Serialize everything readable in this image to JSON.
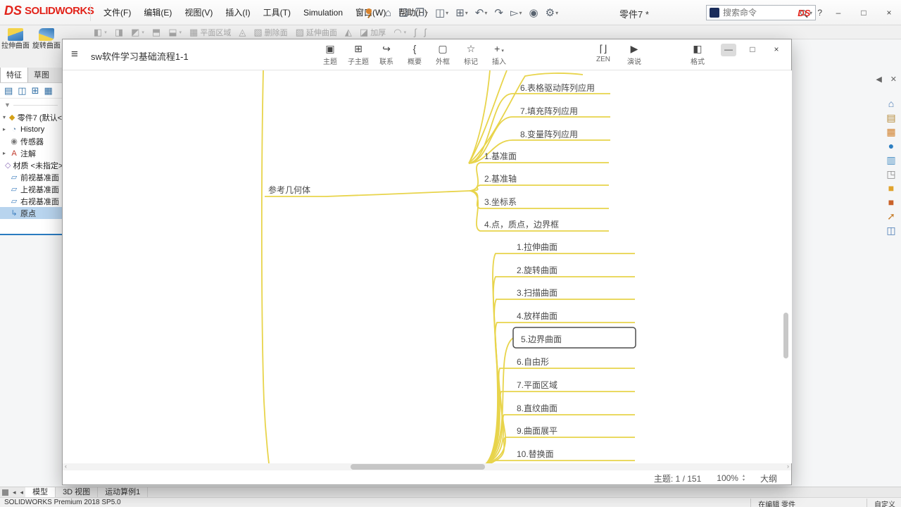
{
  "app": {
    "titlebar": {
      "logo_ds": "DS",
      "logo_text": "SOLIDWORKS",
      "menus": [
        "文件(F)",
        "编辑(E)",
        "视图(V)",
        "插入(I)",
        "工具(T)",
        "Simulation",
        "窗口(W)",
        "帮助(H)"
      ],
      "quick_icons": [
        {
          "name": "home-icon",
          "glyph": "⌂",
          "caret": false
        },
        {
          "name": "new-document-icon",
          "glyph": "❏",
          "caret": false
        },
        {
          "name": "open-icon",
          "glyph": "❐",
          "caret": true
        },
        {
          "name": "save-icon",
          "glyph": "◫",
          "caret": true
        },
        {
          "name": "print-icon",
          "glyph": "⊞",
          "caret": true
        },
        {
          "name": "undo-icon",
          "glyph": "↶",
          "caret": true
        },
        {
          "name": "redo-icon",
          "glyph": "↷",
          "caret": false
        },
        {
          "name": "select-arrow-icon",
          "glyph": "▻",
          "caret": true
        },
        {
          "name": "rebuild-icon",
          "glyph": "◉",
          "caret": false
        },
        {
          "name": "options-icon",
          "glyph": "⚙",
          "caret": true
        }
      ],
      "doc_title": "零件7 *",
      "search_placeholder": "搜索命令",
      "help_label": "?",
      "minimize_label": "–",
      "maximize_label": "□",
      "close_label": "×"
    },
    "ribbon_items": [
      {
        "name": "extruded-surface-icon",
        "glyph": "◧",
        "caret": true
      },
      {
        "name": "revolved-surface-icon",
        "glyph": "◨",
        "caret": false
      },
      {
        "name": "swept-surface-icon",
        "glyph": "◩",
        "caret": true
      },
      {
        "name": "lofted-surface-icon",
        "glyph": "⬒",
        "caret": false
      },
      {
        "name": "boundary-surface-icon",
        "glyph": "⬓",
        "caret": true
      },
      {
        "name": "planar-surface-button",
        "glyph": "▦",
        "label": "平面区域"
      },
      {
        "name": "offset-surface-icon",
        "glyph": "◬",
        "caret": false
      },
      {
        "name": "delete-face-button",
        "glyph": "▧",
        "label": "删除面"
      },
      {
        "name": "extend-surface-button",
        "glyph": "▨",
        "label": "延伸曲面"
      },
      {
        "name": "trim-surface-icon",
        "glyph": "◭",
        "caret": false
      },
      {
        "name": "thicken-button",
        "glyph": "◪",
        "label": "加厚"
      },
      {
        "name": "fillet-icon",
        "glyph": "◠",
        "caret": true
      },
      {
        "name": "freeform-icon",
        "glyph": "∫",
        "caret": false
      },
      {
        "name": "curve-wizard-icon",
        "glyph": "ʃ",
        "caret": false
      }
    ],
    "left_panel": {
      "surface_buttons": [
        {
          "name": "extruded-surface-button",
          "label": "拉伸曲面"
        },
        {
          "name": "revolved-surface-button",
          "label": "旋转曲面"
        }
      ],
      "tabs": [
        "特征",
        "草图"
      ],
      "manager_icons": [
        {
          "name": "feature-tree-icon",
          "glyph": "▤"
        },
        {
          "name": "property-manager-icon",
          "glyph": "◫"
        },
        {
          "name": "configuration-icon",
          "glyph": "⊞"
        },
        {
          "name": "dimxpert-icon",
          "glyph": "▦"
        }
      ],
      "tree": {
        "root": "零件7 (默认<",
        "items": [
          {
            "name": "tree-item-history",
            "glyph": "◔",
            "color": "#6f8fb0",
            "label": "History",
            "expand": true
          },
          {
            "name": "tree-item-sensors",
            "glyph": "◉",
            "color": "#7a7a7a",
            "label": "传感器",
            "expand": false
          },
          {
            "name": "tree-item-annotations",
            "glyph": "A",
            "color": "#c0392b",
            "label": "注解",
            "expand": true
          },
          {
            "name": "tree-item-material",
            "glyph": "◇",
            "color": "#8e6fb8",
            "label": "材质 <未指定>",
            "expand": false
          },
          {
            "name": "tree-item-front-plane",
            "glyph": "▱",
            "color": "#3f7fbf",
            "label": "前视基准面",
            "expand": false
          },
          {
            "name": "tree-item-top-plane",
            "glyph": "▱",
            "color": "#3f7fbf",
            "label": "上视基准面",
            "expand": false
          },
          {
            "name": "tree-item-right-plane",
            "glyph": "▱",
            "color": "#3f7fbf",
            "label": "右视基准面",
            "expand": false
          },
          {
            "name": "tree-item-origin",
            "glyph": "↳",
            "color": "#3f7fbf",
            "label": "原点",
            "expand": false,
            "selected": true
          }
        ]
      }
    },
    "task_pane": {
      "collapse_glyph": "◀",
      "close_glyph": "✕",
      "icons": [
        {
          "name": "task-home-icon",
          "glyph": "⌂",
          "color": "#4a7ab5"
        },
        {
          "name": "design-library-icon",
          "glyph": "▤",
          "color": "#b58a3a"
        },
        {
          "name": "file-explorer-icon",
          "glyph": "▦",
          "color": "#d17f2a"
        },
        {
          "name": "appearances-icon",
          "glyph": "●",
          "color": "#2e7fc2"
        },
        {
          "name": "custom-properties-icon",
          "glyph": "▥",
          "color": "#4a90c4"
        },
        {
          "name": "view-palette-icon",
          "glyph": "◳",
          "color": "#888888"
        },
        {
          "name": "decals-icon",
          "glyph": "■",
          "color": "#e0a32e"
        },
        {
          "name": "scenes-icon",
          "glyph": "■",
          "color": "#c9622a"
        },
        {
          "name": "forum-icon",
          "glyph": "➚",
          "color": "#c77f2e"
        },
        {
          "name": "display-manager-icon",
          "glyph": "◫",
          "color": "#4a7ab5"
        }
      ]
    },
    "bottom": {
      "tabs": [
        "模型",
        "3D 视图",
        "运动算例1"
      ],
      "active_tab": "模型",
      "status_left": "SOLIDWORKS Premium 2018 SP5.0",
      "status_editing": "在编辑 零件",
      "status_customize": "自定义"
    }
  },
  "xmind": {
    "window_title": "sw软件学习基础流程1-1",
    "hamburger_glyph": "≡",
    "toolbar": [
      {
        "name": "topic-button",
        "icon_glyph": "▣",
        "label": "主题",
        "caret": false
      },
      {
        "name": "subtopic-button",
        "icon_glyph": "⊞",
        "label": "子主题",
        "caret": false
      },
      {
        "name": "relationship-button",
        "icon_glyph": "↪",
        "label": "联系",
        "caret": false
      },
      {
        "name": "summary-button",
        "icon_glyph": "{",
        "label": "概要",
        "caret": false
      },
      {
        "name": "boundary-button",
        "icon_glyph": "▢",
        "label": "外框",
        "caret": false
      },
      {
        "name": "marker-button",
        "icon_glyph": "☆",
        "label": "标记",
        "caret": false
      },
      {
        "name": "insert-button",
        "icon_glyph": "+",
        "label": "插入",
        "caret": true
      }
    ],
    "right_buttons": [
      {
        "name": "zen-button",
        "icon_glyph": "⌈⌋",
        "label": "ZEN",
        "caret": false
      },
      {
        "name": "present-button",
        "icon_glyph": "▶",
        "label": "演说",
        "caret": false
      }
    ],
    "format_button": {
      "name": "format-button",
      "icon_glyph": "◧",
      "label": "格式"
    },
    "window_controls": {
      "minimize": "—",
      "maximize": "□",
      "close": "×"
    },
    "status": {
      "topic_count": "主题: 1 / 151",
      "zoom": "100%",
      "outline_label": "大纲"
    },
    "mindmap": {
      "branch_color": "#e8d44b",
      "text_color": "#4a4a4a",
      "selection_color": "#4d4d4d",
      "nodes": [
        "6.表格驱动阵列应用",
        "7.填充阵列应用",
        "8.变量阵列应用",
        "参考几何体",
        "1.基准面",
        "2.基准轴",
        "3.坐标系",
        "4.点，质点，边界框",
        "1.拉伸曲面",
        "2.旋转曲面",
        "3.扫描曲面",
        "4.放样曲面",
        "5.边界曲面",
        "6.自由形",
        "7.平面区域",
        "8.直纹曲面",
        "9.曲面展平",
        "10.替换面"
      ],
      "selected_node": "5.边界曲面"
    }
  }
}
